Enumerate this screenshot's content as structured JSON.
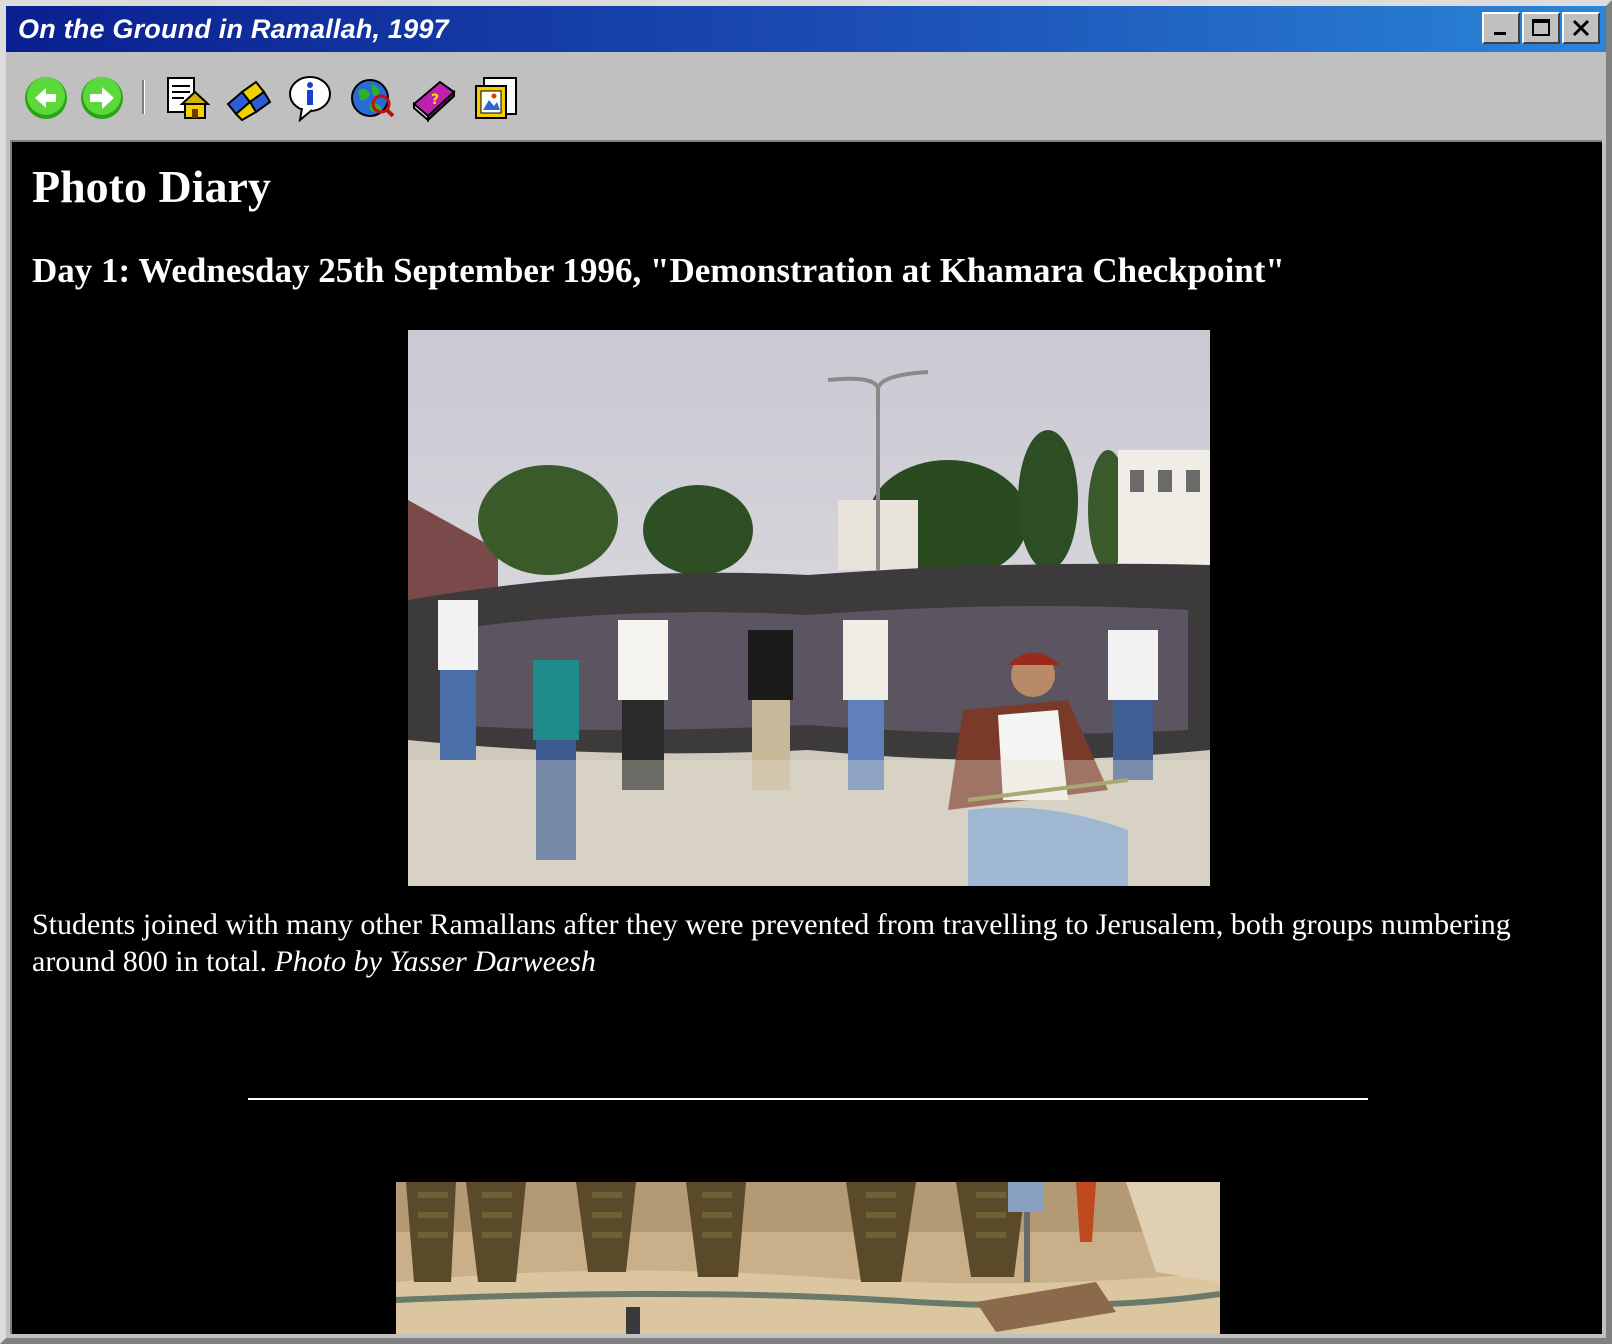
{
  "window": {
    "title": "On the Ground in Ramallah, 1997",
    "controls": [
      "minimize",
      "maximize",
      "close"
    ]
  },
  "toolbar": {
    "buttons": [
      {
        "name": "back",
        "icon": "back-arrow-icon",
        "color": "#3cc21e"
      },
      {
        "name": "forward",
        "icon": "forward-arrow-icon",
        "color": "#3cc21e"
      },
      {
        "name": "home",
        "icon": "home-page-icon"
      },
      {
        "name": "links",
        "icon": "links-puzzle-icon"
      },
      {
        "name": "info",
        "icon": "info-icon"
      },
      {
        "name": "web",
        "icon": "globe-search-icon"
      },
      {
        "name": "help",
        "icon": "help-book-icon"
      },
      {
        "name": "gallery",
        "icon": "picture-frame-icon"
      }
    ]
  },
  "page": {
    "heading": "Photo Diary",
    "day_heading": "Day 1: Wednesday 25th September 1996, \"Demonstration at Khamara Checkpoint\"",
    "caption_text": "Students joined with many other Ramallans after they were prevented from travelling to Jerusalem, both groups numbering around 800 in total. ",
    "caption_credit": "Photo by Yasser Darweesh"
  },
  "colors": {
    "background": "#000000",
    "text": "#ffffff",
    "titlebar_start": "#0a1f8f",
    "titlebar_end": "#2a86d8",
    "chrome": "#c0c0c0"
  }
}
